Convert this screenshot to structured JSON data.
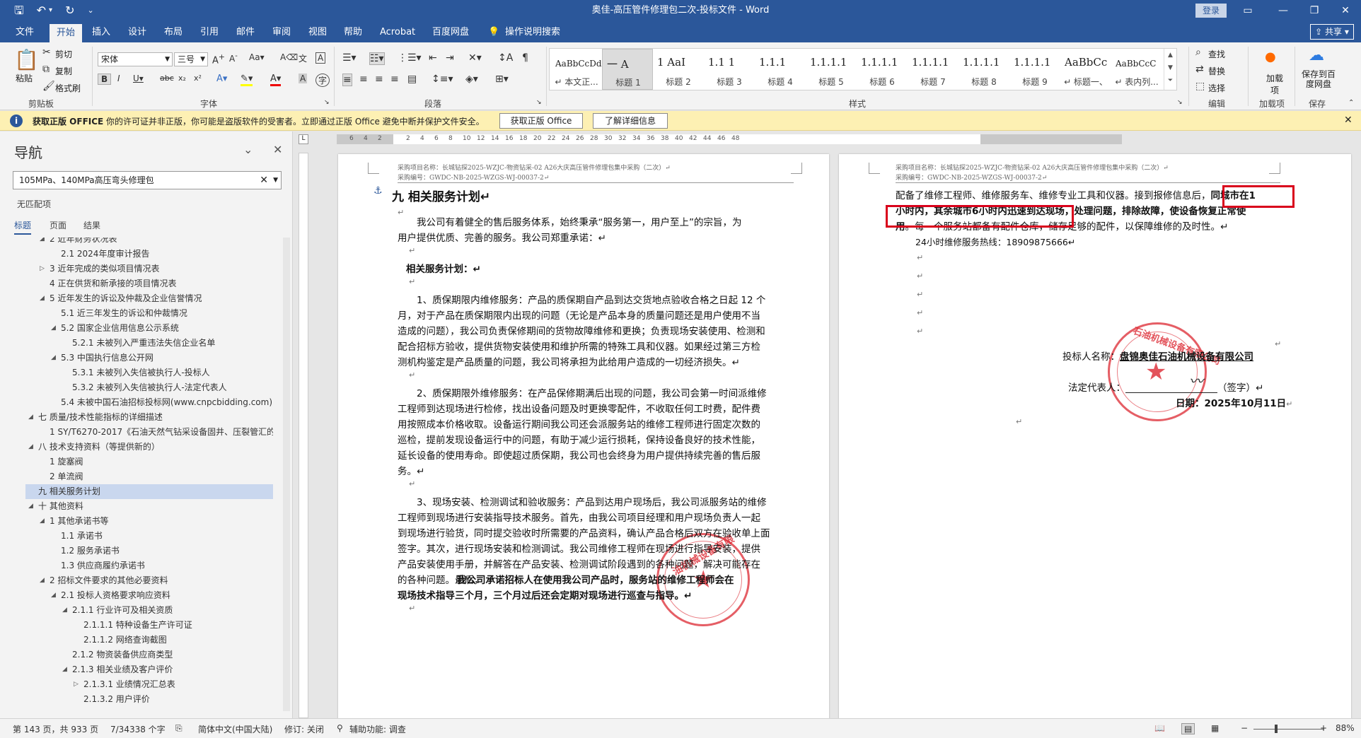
{
  "window": {
    "title": "奥佳-高压管件修理包二次-投标文件 - Word",
    "login_label": "登录",
    "share_label": "共享"
  },
  "menu": {
    "items": [
      "文件",
      "开始",
      "插入",
      "设计",
      "布局",
      "引用",
      "邮件",
      "审阅",
      "视图",
      "帮助",
      "Acrobat",
      "百度网盘"
    ],
    "active": "开始",
    "tell_me": "操作说明搜索"
  },
  "ribbon": {
    "clipboard": {
      "paste": "粘贴",
      "cut": "剪切",
      "copy": "复制",
      "format_painter": "格式刷",
      "label": "剪贴板"
    },
    "font": {
      "name": "宋体",
      "size": "三号",
      "label": "字体"
    },
    "paragraph_label": "段落",
    "styles": {
      "label": "样式",
      "items": [
        {
          "sample": "AaBbCcDdI",
          "name": "↵ 本文正..."
        },
        {
          "sample": "一 A",
          "name": "标题 1"
        },
        {
          "sample": "1 AaI",
          "name": "标题 2"
        },
        {
          "sample": "1.1 1",
          "name": "标题 3"
        },
        {
          "sample": "1.1.1",
          "name": "标题 4"
        },
        {
          "sample": "1.1.1.1",
          "name": "标题 5"
        },
        {
          "sample": "1.1.1.1",
          "name": "标题 6"
        },
        {
          "sample": "1.1.1.1",
          "name": "标题 7"
        },
        {
          "sample": "1.1.1.1",
          "name": "标题 8"
        },
        {
          "sample": "1.1.1.1",
          "name": "标题 9"
        },
        {
          "sample": "AaBbCc",
          "name": "↵ 标题一、"
        },
        {
          "sample": "AaBbCcC",
          "name": "↵ 表内列..."
        }
      ]
    },
    "editing": {
      "find": "查找",
      "replace": "替换",
      "select": "选择",
      "label": "编辑"
    },
    "addins": {
      "button": "加载项",
      "label": "加载项"
    },
    "save": {
      "button": "保存到百度网盘",
      "label": "保存"
    }
  },
  "notice": {
    "title": "获取正版 OFFICE",
    "message": "你的许可证并非正版，你可能是盗版软件的受害者。立即通过正版 Office 避免中断并保护文件安全。",
    "btn_genuine": "获取正版 Office",
    "btn_learn": "了解详细信息"
  },
  "nav": {
    "title": "导航",
    "search_value": "105MPa、140MPa高压弯头修理包",
    "no_match": "无匹配项",
    "tabs": [
      "标题",
      "页面",
      "结果"
    ],
    "items": [
      {
        "label": "2 近年财务状况表",
        "level": 2,
        "tri": "open"
      },
      {
        "label": "2.1 2024年度审计报告",
        "level": 3,
        "tri": ""
      },
      {
        "label": "3 近年完成的类似项目情况表",
        "level": 2,
        "tri": "closed"
      },
      {
        "label": "4 正在供货和新承接的项目情况表",
        "level": 2,
        "tri": ""
      },
      {
        "label": "5 近年发生的诉讼及仲裁及企业信誉情况",
        "level": 2,
        "tri": "open"
      },
      {
        "label": "5.1 近三年发生的诉讼和仲裁情况",
        "level": 3,
        "tri": ""
      },
      {
        "label": "5.2 国家企业信用信息公示系统",
        "level": 3,
        "tri": "open"
      },
      {
        "label": "5.2.1 未被列入严重违法失信企业名单",
        "level": 4,
        "tri": ""
      },
      {
        "label": "5.3 中国执行信息公开网",
        "level": 3,
        "tri": "open"
      },
      {
        "label": "5.3.1 未被列入失信被执行人-投标人",
        "level": 4,
        "tri": ""
      },
      {
        "label": "5.3.2 未被列入失信被执行人-法定代表人",
        "level": 4,
        "tri": ""
      },
      {
        "label": "5.4 未被中国石油招标投标网(www.cnpcbidding.com)...",
        "level": 3,
        "tri": ""
      },
      {
        "label": "七 质量/技术性能指标的详细描述",
        "level": 1,
        "tri": "open"
      },
      {
        "label": "1 SY/T6270-2017《石油天然气钻采设备固井、压裂管汇的...",
        "level": 2,
        "tri": ""
      },
      {
        "label": "八 技术支持资料（等提供新的）",
        "level": 1,
        "tri": "open"
      },
      {
        "label": "1 旋塞阀",
        "level": 2,
        "tri": ""
      },
      {
        "label": "2 单流阀",
        "level": 2,
        "tri": ""
      },
      {
        "label": "九 相关服务计划",
        "level": 1,
        "tri": "",
        "selected": true
      },
      {
        "label": "十 其他资料",
        "level": 1,
        "tri": "open"
      },
      {
        "label": "1 其他承诺书等",
        "level": 2,
        "tri": "open"
      },
      {
        "label": "1.1 承诺书",
        "level": 3,
        "tri": ""
      },
      {
        "label": "1.2 服务承诺书",
        "level": 3,
        "tri": ""
      },
      {
        "label": "1.3 供应商履约承诺书",
        "level": 3,
        "tri": ""
      },
      {
        "label": "2 招标文件要求的其他必要资料",
        "level": 2,
        "tri": "open"
      },
      {
        "label": "2.1 投标人资格要求响应资料",
        "level": 3,
        "tri": "open"
      },
      {
        "label": "2.1.1 行业许可及相关资质",
        "level": 4,
        "tri": "open"
      },
      {
        "label": "2.1.1.1 特种设备生产许可证",
        "level": 5,
        "tri": ""
      },
      {
        "label": "2.1.1.2 网络查询截图",
        "level": 5,
        "tri": ""
      },
      {
        "label": "2.1.2 物资装备供应商类型",
        "level": 4,
        "tri": ""
      },
      {
        "label": "2.1.3 相关业绩及客户评价",
        "level": 4,
        "tri": "open"
      },
      {
        "label": "2.1.3.1 业绩情况汇总表",
        "level": 5,
        "tri": "closed"
      },
      {
        "label": "2.1.3.2 用户评价",
        "level": 5,
        "tri": ""
      }
    ]
  },
  "page1": {
    "header1": "采购项目名称：长城钻探2025-WZJC-物资钻采-02 A26大庆高压管件修理包集中采购（二次）↵",
    "header2": "采购编号：GWDC-NB-2025-WZGS-WJ-00037-2↵",
    "heading": "九 相关服务计划↵",
    "lines": [
      "　　我公司有着健全的售后服务体系，始终秉承“服务第一，用户至上”的宗旨，为",
      "用户提供优质、完善的服务。我公司郑重承诺：↵",
      "相关服务计划：↵",
      "　　1、质保期限内维修服务：产品的质保期自产品到达交货地点验收合格之日起 12 个",
      "月，对于产品在质保期限内出现的问题（无论是产品本身的质量问题还是用户使用不当",
      "造成的问题），我公司负责保修期间的货物故障维修和更换；负责现场安装使用、检测和",
      "配合招标方验收，提供货物安装使用和维护所需的特殊工具和仪器。如果经过第三方检",
      "测机构鉴定是产品质量的问题，我公司将承担为此给用户造成的一切经济损失。↵",
      "　　2、质保期限外维修服务：在产品保修期满后出现的问题，我公司会第一时间派维修",
      "工程师到达现场进行检修，找出设备问题及时更换零配件，不收取任何工时费，配件费",
      "用按照成本价格收取。设备运行期间我公司还会派服务站的维修工程师进行固定次数的",
      "巡检，提前发现设备运行中的问题，有助于减少运行损耗，保持设备良好的技术性能，",
      "延长设备的使用寿命。即使超过质保期，我公司也会终身为用户提供持续完善的售后服",
      "务。↵",
      "　　3、现场安装、检测调试和验收服务：产品到达用户现场后，我公司派服务站的维修",
      "工程师到现场进行安装指导技术服务。首先，由我公司项目经理和用户现场负责人一起",
      "到现场进行验货，同时提交验收时所需要的产品资料，确认产品合格后双方在验收单上面",
      "签字。其次，进行现场安装和检测调试。我公司维修工程师在现场进行指导安装，提供",
      "产品安装使用手册，并解答在产品安装、检测调试阶段遇到的各种问题，解决可能存在",
      "的各种问题。最后，",
      "我公司承诺招标人在使用我公司产品时，服务站的维修工程师会在",
      "现场技术指导三个月，三个月过后还会定期对现场进行巡查与指导。↵"
    ],
    "stamp_text": "油机械设备有限"
  },
  "page2": {
    "header1": "采购项目名称：长城钻探2025-WZJC-物资钻采-02 A26大庆高压管件修理包集中采购（二次）↵",
    "header2": "采购编号：GWDC-NB-2025-WZGS-WJ-00037-2↵",
    "line1a": "配备了维修工程师、维修服务车、维修专业工具和仪器。接到报修信息后，",
    "line1b": "同城市在1",
    "line2a": "小时内，其余城市6小时内迅速到达现场",
    "line2b": "，处理问题，排除故障，使设备恢复正常使",
    "line3a": "用",
    "line3b": "。每一个服务站都备有配件仓库，储存足够的配件，以保障维修的及时性。↵",
    "hotline": "24小时维修服务热线：18909875666↵",
    "bidder_label": "投标人名称：",
    "bidder_name": "盘锦奥佳石油机械设备有限公司",
    "legal_label": "法定代表人：",
    "sign_label": "（签字）↵",
    "date_label": "日期：",
    "date_value": "2025年10月11日",
    "stamp_text": "石油机械设备有限公司"
  },
  "ruler": {
    "ticks": [
      "6",
      "4",
      "2",
      "2",
      "4",
      "6",
      "8",
      "10",
      "12",
      "14",
      "16",
      "18",
      "20",
      "22",
      "24",
      "26",
      "28",
      "30",
      "32",
      "34",
      "36",
      "38",
      "40",
      "42",
      "44",
      "46",
      "48"
    ]
  },
  "status": {
    "page": "第 143 页，共 933 页",
    "words": "7/34338 个字",
    "language": "简体中文(中国大陆)",
    "track": "修订: 关闭",
    "accessibility": "辅助功能: 调查",
    "zoom": "88%"
  },
  "colors": {
    "accent": "#2b579a",
    "highlight_box": "#d9001b",
    "stamp": "#dc2832",
    "notice_bg": "#fdf0b3"
  }
}
